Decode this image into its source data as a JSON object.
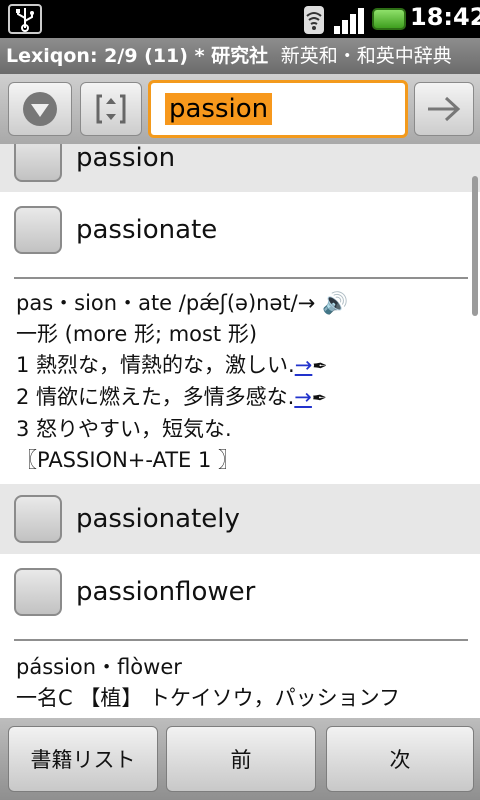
{
  "status": {
    "time": "18:42"
  },
  "titlebar": {
    "app": "Lexiqon: 2/9 (11) * 研究社",
    "dictionary": "新英和・和英中辞典"
  },
  "toolbar": {
    "query": "passion"
  },
  "rows": [
    {
      "word": "passion"
    },
    {
      "word": "passionate"
    },
    {
      "word": "passionately"
    },
    {
      "word": "passionflower"
    }
  ],
  "definition1": {
    "headword": "pas・sion・ate /pǽʃ(ə)nət/→",
    "line_pos": "一形 (more 形; most 形)",
    "sense1": "1 熱烈な，情熱的な，激しい.",
    "sense2": "2 情欲に燃えた，多情多感な.",
    "sense3": "3 怒りやすい，短気な.",
    "etym": "〖PASSION+-ATE 1 〗",
    "link": "→"
  },
  "definition2": {
    "headword": "pássion・flòwer",
    "sense": "一名C 【植】 トケイソウ，パッションフ"
  },
  "bottombar": {
    "book_list": "書籍リスト",
    "prev": "前",
    "next": "次"
  },
  "colors": {
    "accent": "#f39a1c",
    "link": "#2233cc"
  }
}
